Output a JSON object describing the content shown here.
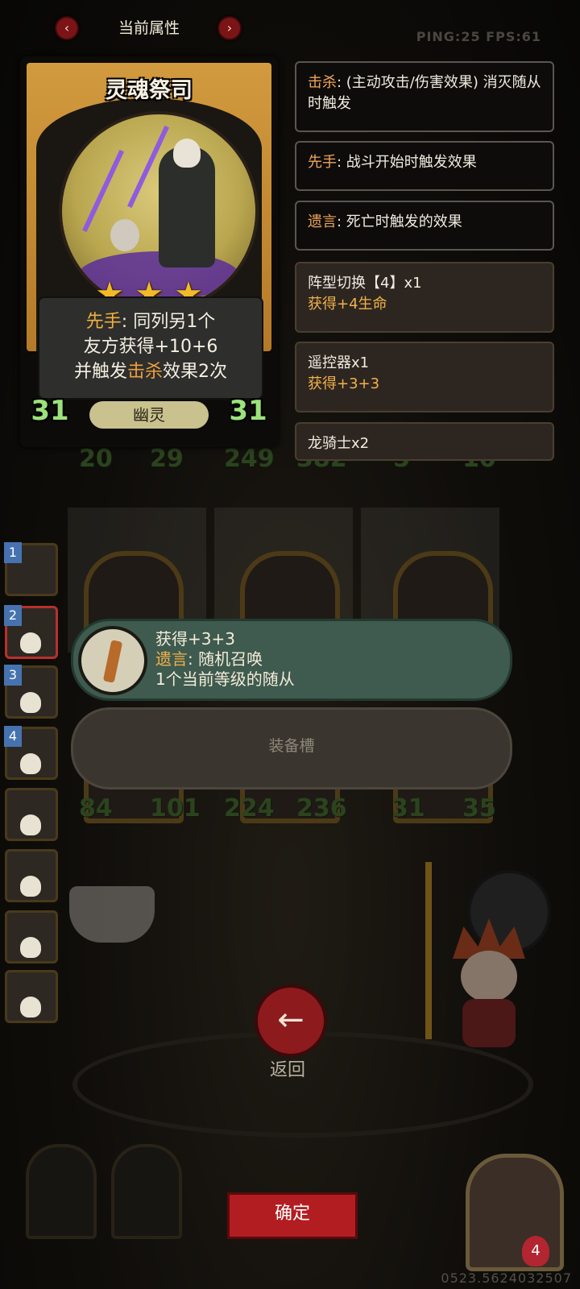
{
  "topbar": {
    "title": "当前属性",
    "prev_icon": "chevron-left-icon",
    "next_icon": "chevron-right-icon",
    "ping_fps": "PING:25 FPS:61"
  },
  "card": {
    "name": "灵魂祭司",
    "stars": [
      "★",
      "★",
      "★"
    ],
    "desc_line1_kw": "先手",
    "desc_line1_rest": ": 同列另1个",
    "desc_line2": "友方获得+10+6",
    "desc_line3_pre": "并触发",
    "desc_line3_kw": "击杀",
    "desc_line3_post": "效果2次",
    "attack": "31",
    "health": "31",
    "tribe": "幽灵"
  },
  "keywords": [
    {
      "name": "击杀",
      "text": ": (主动攻击/伤害效果) 消灭随从时触发"
    },
    {
      "name": "先手",
      "text": ": 战斗开始时触发效果"
    },
    {
      "name": "遗言",
      "text": ": 死亡时触发的效果"
    }
  ],
  "items": [
    {
      "name": "阵型切换【4】x1",
      "effect": "获得+4生命"
    },
    {
      "name": "遥控器x1",
      "effect": "获得+3+3"
    },
    {
      "name": "龙骑士x2",
      "effect": ""
    }
  ],
  "board": {
    "top_stats": [
      "20",
      "29",
      "249",
      "382",
      "5",
      "10"
    ],
    "bottom_stats": [
      "84",
      "101",
      "224",
      "236",
      "31",
      "35"
    ]
  },
  "roster_ranks": [
    "1",
    "2",
    "3",
    "4"
  ],
  "tooltip": {
    "line1": "获得+3+3",
    "line2_kw": "遗言",
    "line2_rest": ": 随机召唤",
    "line3": "1个当前等级的随从"
  },
  "equip_slot": "装备槽",
  "back_label": "返回",
  "confirm_label": "确定",
  "player_level": "4",
  "coords": "0523.5624032507",
  "colors": {
    "accent_red": "#b21d22",
    "keyword_orange": "#f2a45a",
    "stat_green": "#9be27a"
  }
}
